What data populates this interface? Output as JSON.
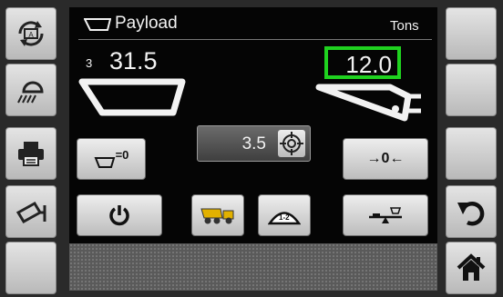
{
  "header": {
    "title": "Payload",
    "unit": "Tons",
    "title_icon": "bucket-icon"
  },
  "payload": {
    "pass_count": "3",
    "bucket_value": "31.5",
    "target_value": "12.0"
  },
  "preset": {
    "value": "3.5",
    "icon": "target-crosshair-icon"
  },
  "left_buttons": [
    {
      "icon": "auto-cycle-icon"
    },
    {
      "icon": "work-light-icon"
    },
    {
      "icon": "printer-icon"
    },
    {
      "icon": "camera-icon"
    },
    {
      "icon": "blank"
    }
  ],
  "right_buttons": [
    {
      "icon": "blank"
    },
    {
      "icon": "blank"
    },
    {
      "icon": "blank"
    },
    {
      "icon": "back-arrow-icon"
    },
    {
      "icon": "home-icon"
    }
  ],
  "center_buttons": {
    "tare_label": "=0",
    "zero_label": "→0←",
    "truck_icon": "dump-truck-icon",
    "pile_label": "1-2",
    "power_icon": "power-icon",
    "scale_icon": "scale-icon"
  },
  "colors": {
    "highlight": "#1fd21f",
    "background": "#050505",
    "button": "#d8d8d8",
    "text": "#f2f2f2"
  }
}
